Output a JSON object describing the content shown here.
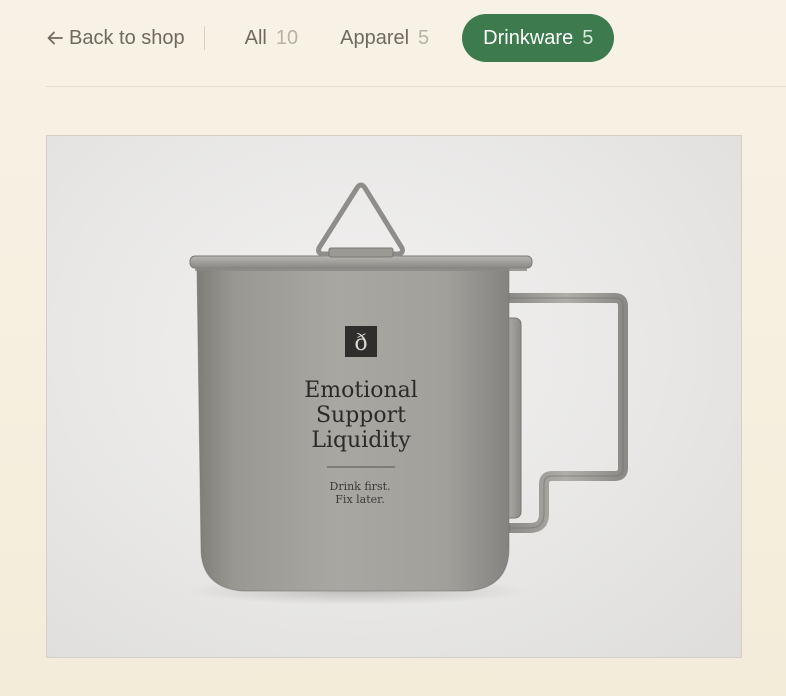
{
  "nav": {
    "back_label": "Back to shop",
    "back_icon": "arrow-left-icon"
  },
  "filters": [
    {
      "label": "All",
      "count": "10",
      "active": false
    },
    {
      "label": "Apparel",
      "count": "5",
      "active": false
    },
    {
      "label": "Drinkware",
      "count": "5",
      "active": true
    }
  ],
  "colors": {
    "accent": "#3d7a4d",
    "background": "#f6f0e2",
    "muted_text": "#6e6a60",
    "count_text": "#b9b3a6"
  },
  "product_image": {
    "mug_title_lines": [
      "Emotional",
      "Support",
      "Liquidity"
    ],
    "mug_tagline_lines": [
      "Drink first.",
      "Fix later."
    ],
    "logo_glyph": "ð"
  }
}
